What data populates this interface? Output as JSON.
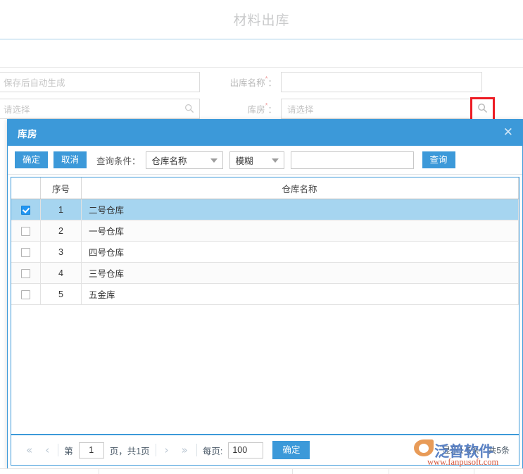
{
  "page": {
    "title": "材料出库",
    "form": {
      "rows": [
        {
          "left_value": "保存后自动生成",
          "label": "出库名称",
          "required_mark": "*",
          "colon": "：",
          "right_value": "",
          "left_icon": "",
          "right_icon": ""
        },
        {
          "left_value": "请选择",
          "label": "库房",
          "required_mark": "*",
          "colon": "：",
          "right_value": "请选择",
          "left_icon": "search-icon",
          "right_icon": "search-icon"
        }
      ]
    }
  },
  "modal": {
    "title": "库房",
    "close_label": "✕",
    "toolbar": {
      "confirm_label": "确定",
      "cancel_label": "取消",
      "condition_label": "查询条件：",
      "field_select": "仓库名称",
      "match_select": "模糊",
      "keyword_value": "",
      "keyword_placeholder": "",
      "query_label": "查询"
    },
    "table": {
      "columns": [
        "",
        "序号",
        "仓库名称"
      ],
      "rows": [
        {
          "checked": true,
          "index": "1",
          "name": "二号仓库"
        },
        {
          "checked": false,
          "index": "2",
          "name": "一号仓库"
        },
        {
          "checked": false,
          "index": "3",
          "name": "四号仓库"
        },
        {
          "checked": false,
          "index": "4",
          "name": "三号仓库"
        },
        {
          "checked": false,
          "index": "5",
          "name": "五金库"
        }
      ]
    },
    "pager": {
      "first_label": "«",
      "prev_label": "‹",
      "page_prefix": "第",
      "page_value": "1",
      "page_suffix": "页，共1页",
      "next_label": "›",
      "last_label": "»",
      "per_page_label": "每页:",
      "per_page_value": "100",
      "confirm_label": "确定",
      "summary": "显示1-5条，共5条"
    }
  },
  "watermark": {
    "brand": "泛普软件",
    "url": "www.fanpusoft.com"
  },
  "colors": {
    "accent": "#3c99d9",
    "selected_row": "#a6d5f0",
    "highlight_box": "#ed1c24",
    "title_text": "#c9cacb"
  }
}
